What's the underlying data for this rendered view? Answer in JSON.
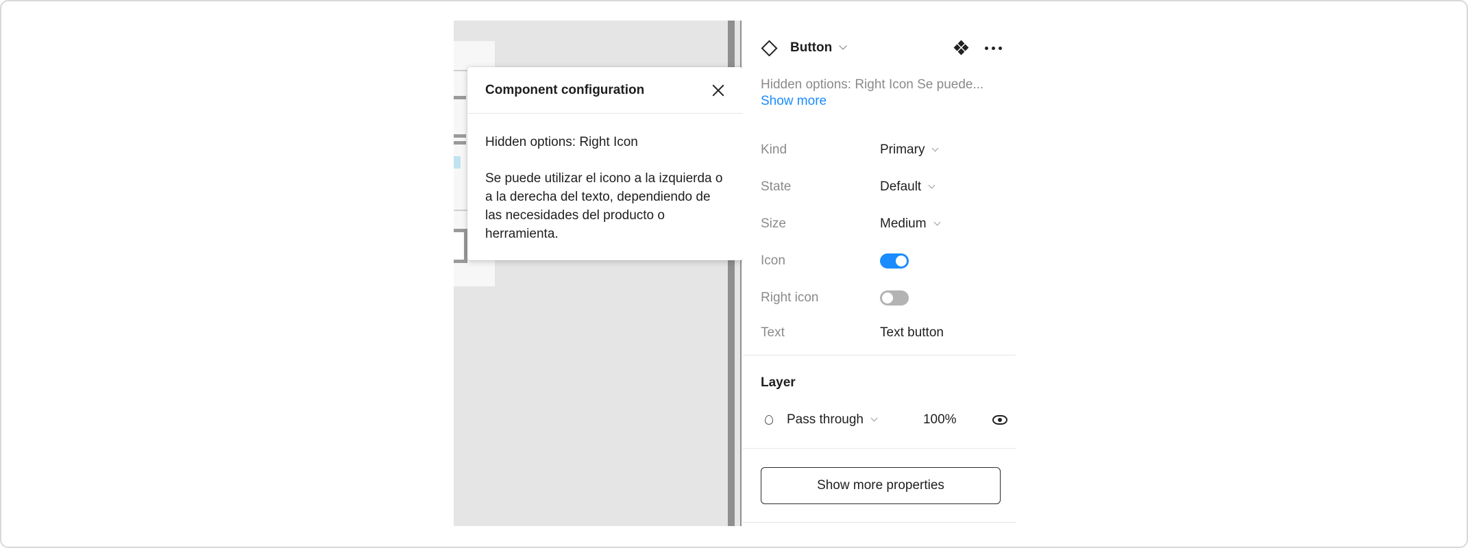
{
  "popover": {
    "title": "Component configuration",
    "hidden_options": "Hidden options: Right Icon",
    "description": "Se puede utilizar el icono a la izquierda o a la derecha del texto, dependiendo de las necesidades del producto o herramienta."
  },
  "panel": {
    "component_name": "Button",
    "description_preview": "Hidden options: Right Icon Se puede...",
    "show_more": "Show more",
    "properties": [
      {
        "label": "Kind",
        "value": "Primary"
      },
      {
        "label": "State",
        "value": "Default"
      },
      {
        "label": "Size",
        "value": "Medium"
      },
      {
        "label": "Icon",
        "value": true
      },
      {
        "label": "Right icon",
        "value": false
      },
      {
        "label": "Text",
        "value": "Text button"
      }
    ],
    "layer": {
      "title": "Layer",
      "blend_mode": "Pass through",
      "opacity": "100%"
    },
    "show_more_properties": "Show more properties"
  },
  "colors": {
    "accent": "#1a8cff",
    "toggle_off": "#b3b3b3",
    "canvas": "#e5e5e5"
  }
}
